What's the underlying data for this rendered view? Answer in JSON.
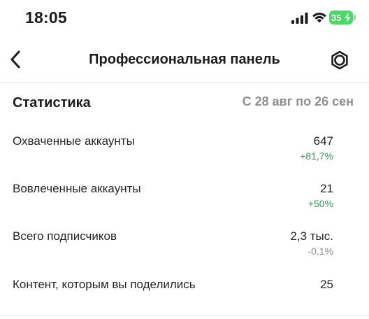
{
  "status_bar": {
    "time": "18:05",
    "battery_level": "35",
    "icons": [
      "signal-icon",
      "wifi-icon",
      "battery-charging-icon"
    ],
    "battery_color": "#4cd964"
  },
  "nav": {
    "back_icon": "chevron-left-icon",
    "title": "Профессиональная панель",
    "settings_icon": "gear-icon"
  },
  "stats": {
    "title": "Статистика",
    "range": "С 28 авг по 26 сен",
    "rows": [
      {
        "label": "Охваченные аккаунты",
        "value": "647",
        "delta": "+81,7%",
        "trend": "up"
      },
      {
        "label": "Вовлеченные аккаунты",
        "value": "21",
        "delta": "+50%",
        "trend": "up"
      },
      {
        "label": "Всего подписчиков",
        "value": "2,3 тыс.",
        "delta": "-0,1%",
        "trend": "neutral"
      },
      {
        "label": "Контент, которым вы поделились",
        "value": "25",
        "delta": "",
        "trend": "none"
      }
    ]
  },
  "colors": {
    "positive": "#2e9e4f",
    "neutral": "#8e8e93",
    "text": "#262626"
  }
}
